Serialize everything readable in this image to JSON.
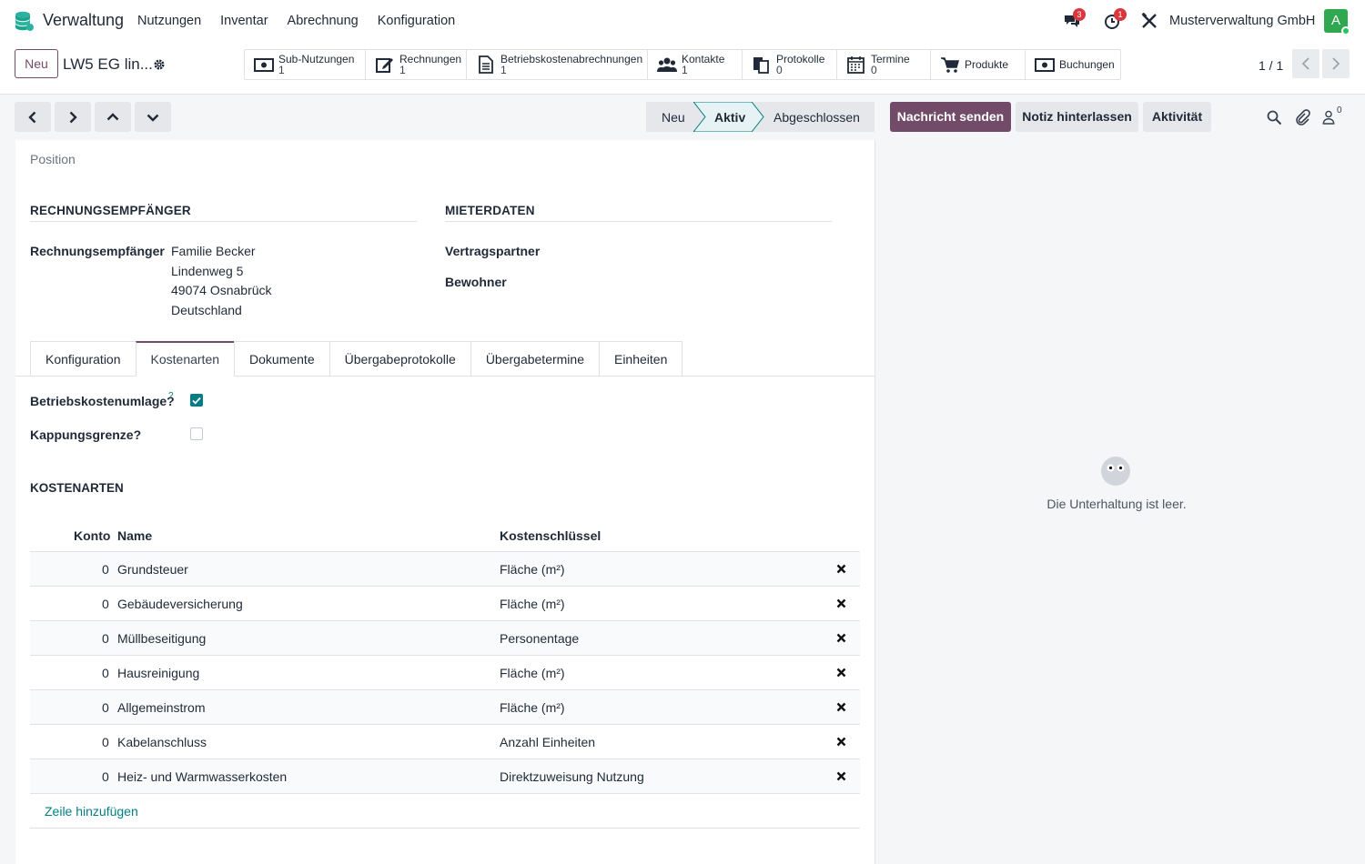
{
  "app": {
    "name": "Verwaltung",
    "menu": [
      "Nutzungen",
      "Inventar",
      "Abrechnung",
      "Konfiguration"
    ],
    "messages_badge": "3",
    "activities_badge": "1",
    "company": "Musterverwaltung GmbH",
    "avatar_letter": "A"
  },
  "control": {
    "new_label": "Neu",
    "record_title": "LW5 EG lin...",
    "smart_buttons": [
      {
        "label": "Sub-Nutzungen",
        "count": "1",
        "icon": "money-icon"
      },
      {
        "label": "Rechnungen",
        "count": "1",
        "icon": "edit-icon"
      },
      {
        "label": "Betriebskostenabrechnungen",
        "count": "1",
        "icon": "file-icon"
      },
      {
        "label": "Kontakte",
        "count": "1",
        "icon": "users-icon"
      },
      {
        "label": "Protokolle",
        "count": "0",
        "icon": "documents-icon"
      },
      {
        "label": "Termine",
        "count": "0",
        "icon": "calendar-icon"
      },
      {
        "label": "Produkte",
        "icon": "cart-icon"
      },
      {
        "label": "Buchungen",
        "icon": "money-icon"
      }
    ],
    "pager": "1 / 1"
  },
  "status": {
    "stages": [
      "Neu",
      "Aktiv",
      "Abgeschlossen"
    ],
    "active_stage": "Aktiv",
    "actions": {
      "send": "Nachricht senden",
      "note": "Notiz hinterlassen",
      "activity": "Aktivität"
    },
    "followers_count": "0"
  },
  "form": {
    "position_label": "Position",
    "recipient_section": "RECHNUNGSEMPFÄNGER",
    "tenant_section": "MIETERDATEN",
    "recipient_label": "Rechnungsempfänger",
    "recipient_lines": [
      "Familie Becker",
      "Lindenweg 5",
      "49074 Osnabrück",
      "Deutschland"
    ],
    "contract_partner_label": "Vertragspartner",
    "resident_label": "Bewohner",
    "tabs": [
      "Konfiguration",
      "Kostenarten",
      "Dokumente",
      "Übergabeprotokolle",
      "Übergabetermine",
      "Einheiten"
    ],
    "active_tab": "Kostenarten",
    "bk_umlage_label": "Betriebskostenumlage?",
    "bk_umlage_help": "?",
    "bk_umlage_checked": true,
    "kappung_label": "Kappungsgrenze?",
    "kappung_checked": false,
    "cost_section": "KOSTENARTEN",
    "table": {
      "headers": {
        "konto": "Konto",
        "name": "Name",
        "key": "Kostenschlüssel"
      },
      "rows": [
        {
          "konto": "0",
          "name": "Grundsteuer",
          "key": "Fläche (m²)"
        },
        {
          "konto": "0",
          "name": "Gebäudeversicherung",
          "key": "Fläche (m²)"
        },
        {
          "konto": "0",
          "name": "Müllbeseitigung",
          "key": "Personentage"
        },
        {
          "konto": "0",
          "name": "Hausreinigung",
          "key": "Fläche (m²)"
        },
        {
          "konto": "0",
          "name": "Allgemeinstrom",
          "key": "Fläche (m²)"
        },
        {
          "konto": "0",
          "name": "Kabelanschluss",
          "key": "Anzahl Einheiten"
        },
        {
          "konto": "0",
          "name": "Heiz- und Warmwasserkosten",
          "key": "Direktzuweisung Nutzung"
        }
      ],
      "add_line": "Zeile hinzufügen"
    }
  },
  "chatter": {
    "empty_text": "Die Unterhaltung ist leer."
  },
  "colors": {
    "brand": "#714b67",
    "accent": "#017e84",
    "badge": "#d9363e",
    "avatar": "#2fa84f"
  }
}
